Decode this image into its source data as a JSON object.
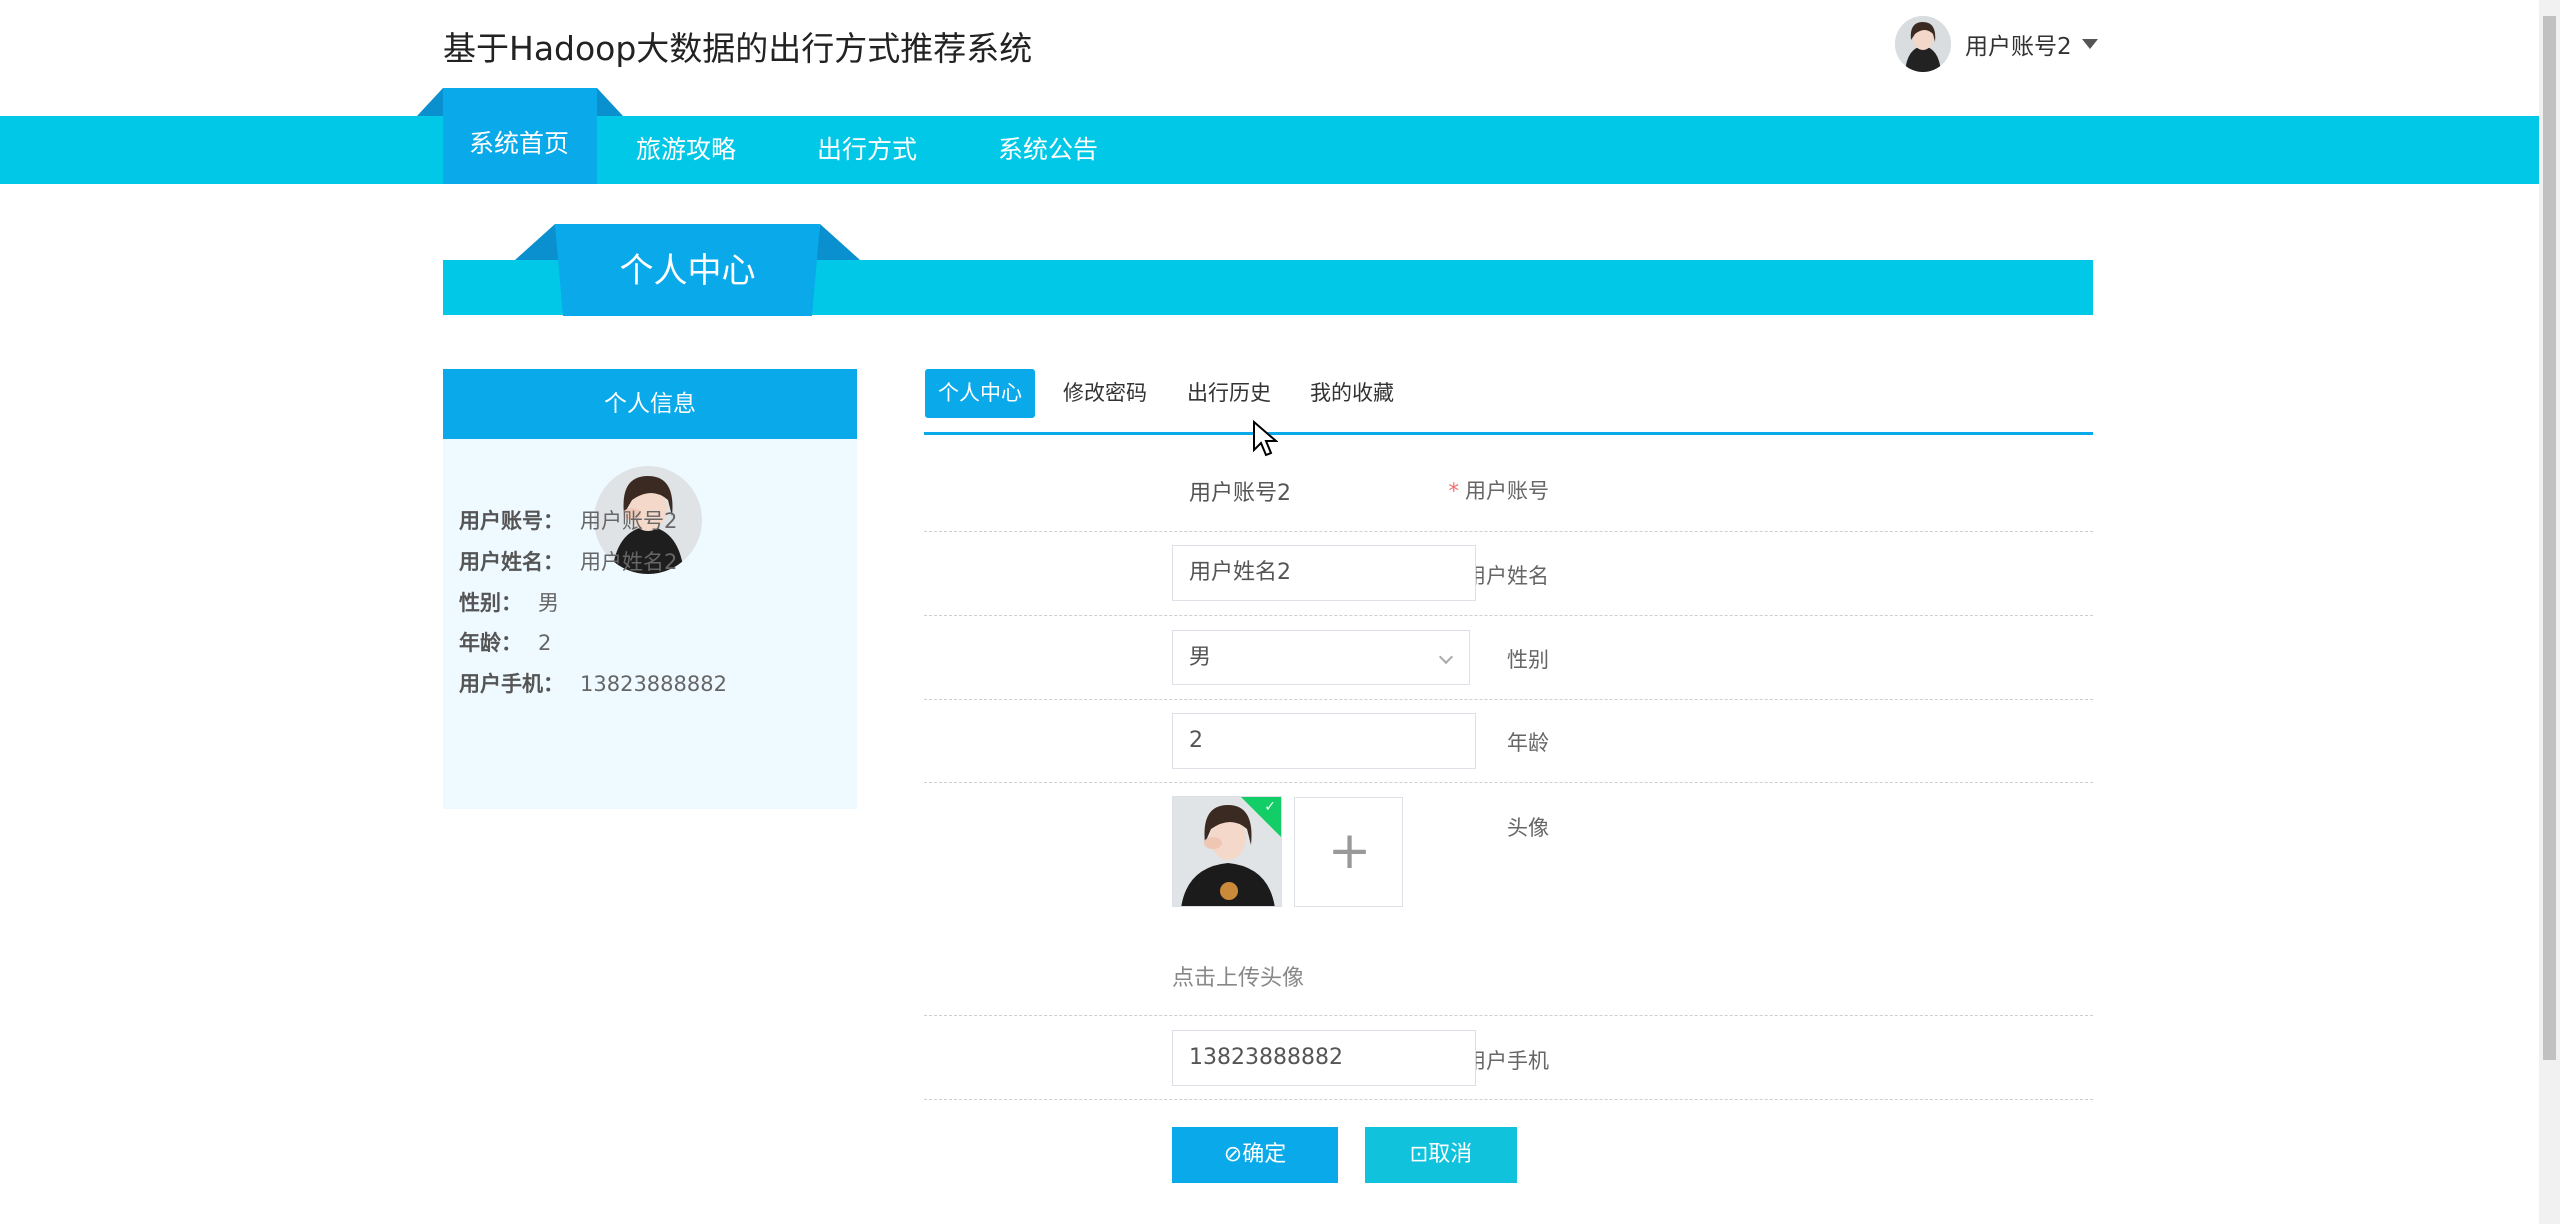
{
  "header": {
    "title": "基于Hadoop大数据的出行方式推荐系统",
    "user_label": "用户账号2"
  },
  "nav": {
    "items": [
      {
        "label": "系统首页",
        "active": true
      },
      {
        "label": "旅游攻略"
      },
      {
        "label": "出行方式"
      },
      {
        "label": "系统公告"
      }
    ]
  },
  "banner": {
    "title": "个人中心"
  },
  "profile_panel": {
    "title": "个人信息",
    "rows": [
      {
        "key": "用户账号：",
        "value": "用户账号2"
      },
      {
        "key": "用户姓名：",
        "value": "用户姓名2"
      },
      {
        "key": "性别：",
        "value": "男"
      },
      {
        "key": "年龄：",
        "value": "2"
      },
      {
        "key": "用户手机：",
        "value": "13823888882"
      }
    ]
  },
  "tabs": [
    {
      "label": "个人中心",
      "active": true
    },
    {
      "label": "修改密码"
    },
    {
      "label": "出行历史"
    },
    {
      "label": "我的收藏"
    }
  ],
  "form": {
    "account_label": "用户账号",
    "account_value": "用户账号2",
    "name_label": "用户姓名",
    "name_value": "用户姓名2",
    "gender_label": "性别",
    "gender_value": "男",
    "age_label": "年龄",
    "age_value": "2",
    "avatar_label": "头像",
    "upload_plus": "+",
    "upload_hint": "点击上传头像",
    "phone_label": "用户手机",
    "phone_value": "13823888882",
    "confirm_label": "确定",
    "cancel_label": "取消"
  },
  "colors": {
    "primary": "#0aa9ea",
    "nav": "#00c8e6",
    "panel_bg": "#eefaff",
    "success": "#13ce66"
  }
}
